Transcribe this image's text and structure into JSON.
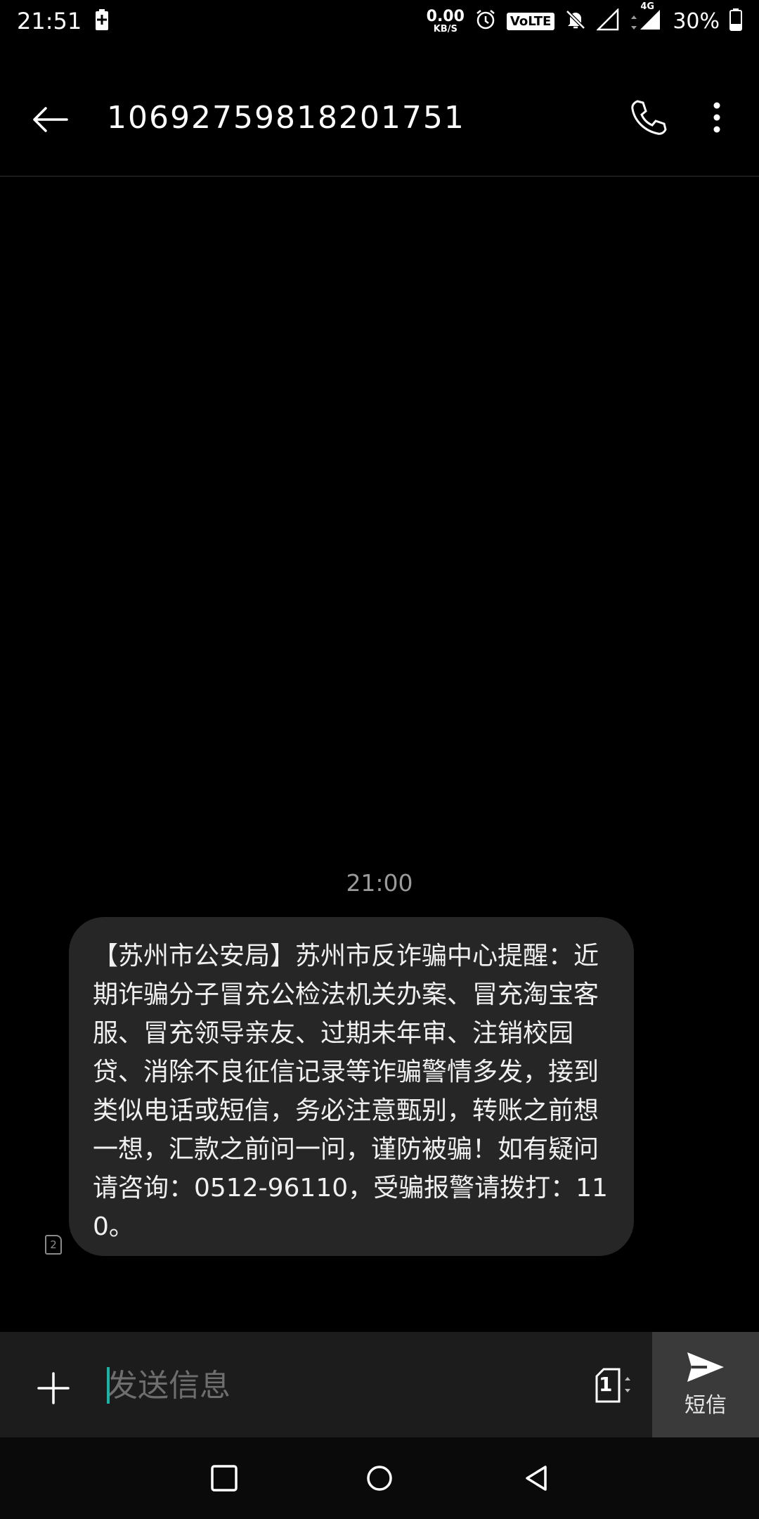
{
  "status_bar": {
    "time": "21:51",
    "net_speed_value": "0.00",
    "net_speed_unit": "KB/S",
    "volte": "VoLTE",
    "network": "4G",
    "battery_percent": "30%",
    "icons": [
      "battery-charging-icon",
      "alarm-icon",
      "mute-icon",
      "signal-icon",
      "battery-icon"
    ]
  },
  "toolbar": {
    "title": "106927598182017​51"
  },
  "conversation": {
    "timestamp": "21:00",
    "message": "【苏州市公安局】苏州市反诈骗中心提醒：近期诈骗分子冒充公检法机关办案、冒充淘宝客服、冒充领导亲友、过期未年审、注销校园贷、消除不良征信记录等诈骗警情多发，接到类似电话或短信，务必注意甄别，转账之前想一想，汇款之前问一问，谨防被骗！如有疑问请咨询：0512-96110，受骗报警请拨打：110。",
    "sim_badge": "2"
  },
  "compose": {
    "placeholder": "发送信息",
    "sim_selected": "1",
    "send_label": "短信"
  },
  "colors": {
    "bubble": "#262626",
    "compose_bg": "#1c1c1c",
    "send_bg": "#3a3a3a",
    "caret": "#1bb3a6"
  }
}
